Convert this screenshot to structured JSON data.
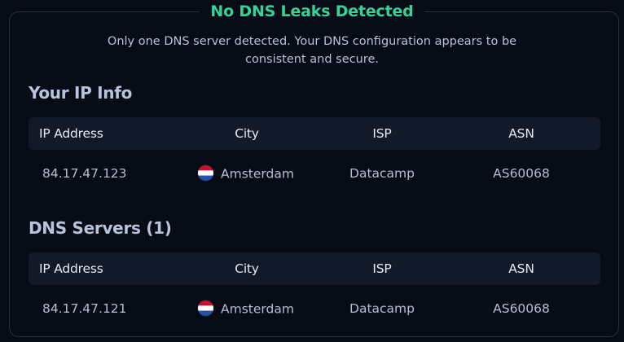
{
  "status": {
    "title": "No DNS Leaks Detected",
    "summary_line1": "Only one DNS server detected. Your DNS configuration appears to be",
    "summary_line2": "consistent and secure."
  },
  "ip_info": {
    "heading": "Your IP Info",
    "columns": [
      "IP Address",
      "City",
      "ISP",
      "ASN"
    ],
    "rows": [
      {
        "ip": "84.17.47.123",
        "flag": "netherlands-flag-icon",
        "city": "Amsterdam",
        "isp": "Datacamp",
        "asn": "AS60068"
      }
    ]
  },
  "dns_servers": {
    "heading": "DNS Servers (1)",
    "columns": [
      "IP Address",
      "City",
      "ISP",
      "ASN"
    ],
    "rows": [
      {
        "ip": "84.17.47.121",
        "flag": "netherlands-flag-icon",
        "city": "Amsterdam",
        "isp": "Datacamp",
        "asn": "AS60068"
      }
    ]
  },
  "colors": {
    "success": "#34d399",
    "background": "#060b15",
    "table_header": "#121a29",
    "border": "#1f3440"
  }
}
